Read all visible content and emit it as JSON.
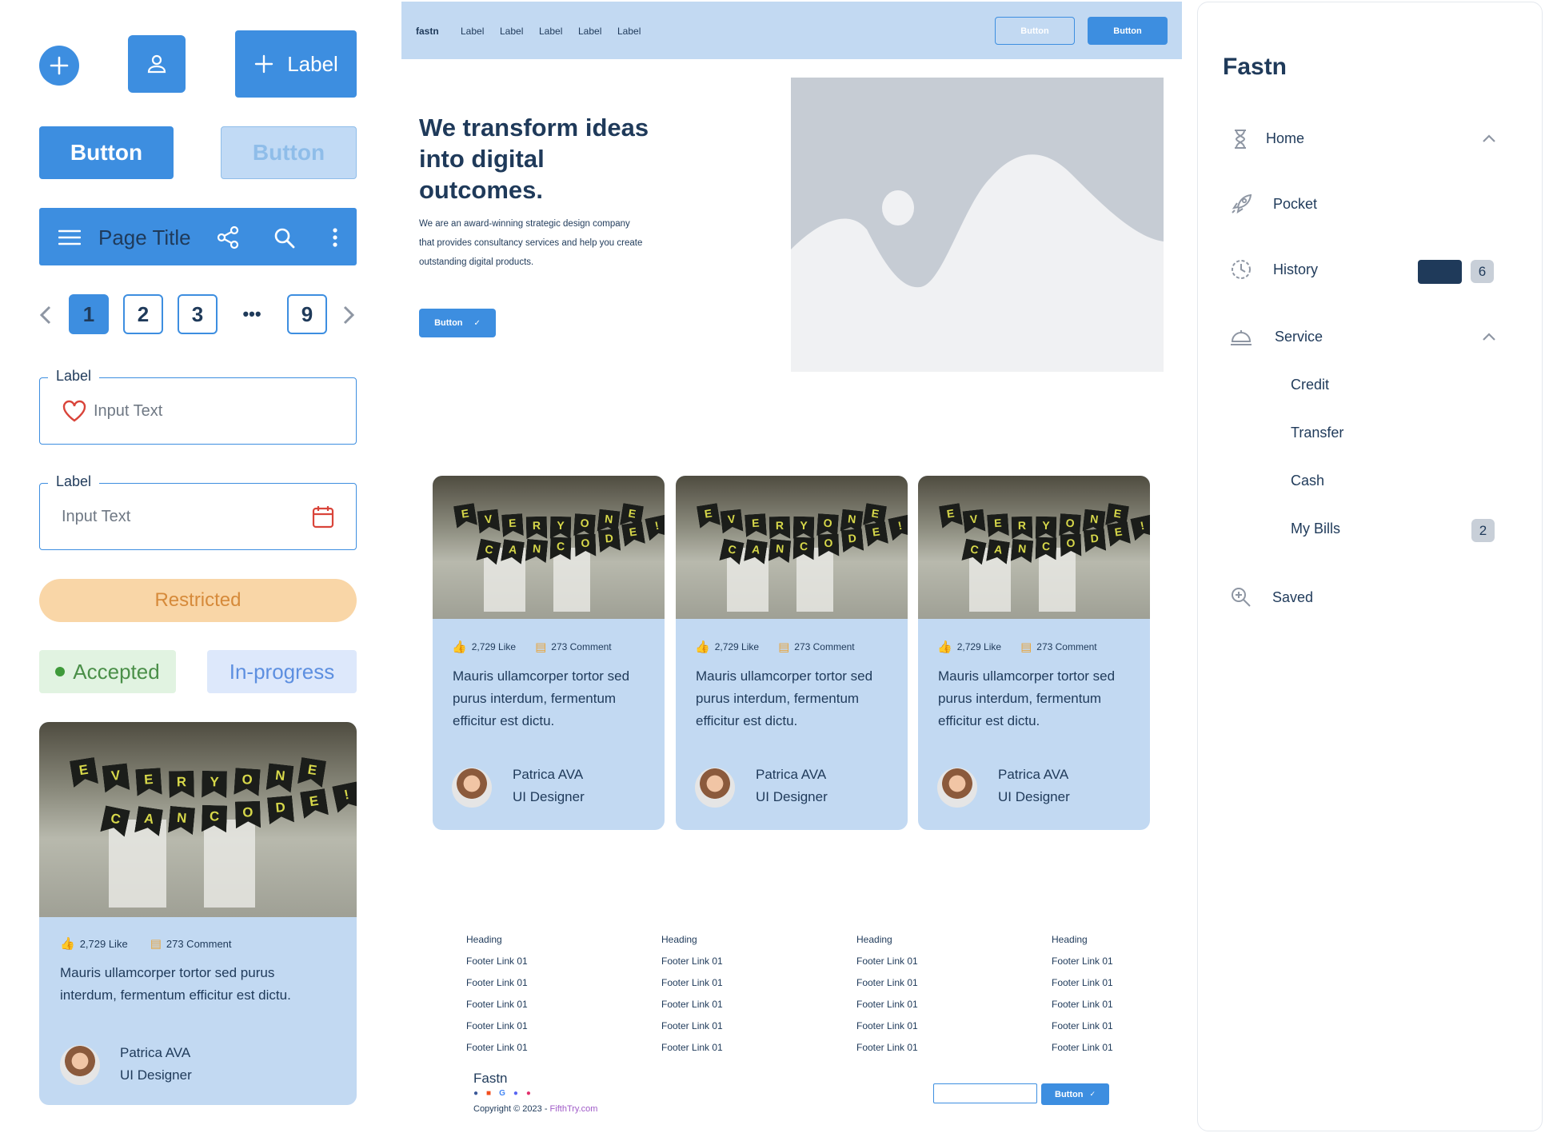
{
  "components": {
    "icon_button_label": "Label",
    "primary_button": "Button",
    "disabled_button": "Button",
    "appbar_title": "Page Title",
    "pagination": [
      "1",
      "2",
      "3",
      "•••",
      "9"
    ],
    "field1": {
      "label": "Label",
      "value": "Input Text"
    },
    "field2": {
      "label": "Label",
      "value": "Input Text"
    },
    "restricted": "Restricted",
    "accepted": "Accepted",
    "in_progress": "In-progress",
    "card": {
      "likes": "2,729 Like",
      "comments": "273 Comment",
      "text": "Mauris ullamcorper tortor sed purus interdum, fermentum efficitur est dictu.",
      "author": "Patrica AVA",
      "role": "UI Designer"
    }
  },
  "photo": {
    "row1": [
      "E",
      "V",
      "E",
      "R",
      "Y",
      "O",
      "N",
      "E"
    ],
    "row2": [
      "C",
      "A",
      "N",
      "C",
      "O",
      "D",
      "E",
      "!"
    ]
  },
  "landing": {
    "brand": "fastn",
    "nav": [
      "Label",
      "Label",
      "Label",
      "Label",
      "Label"
    ],
    "outline_button": "Button",
    "solid_button": "Button",
    "heading": "We transform ideas into digital outcomes.",
    "para": "We are an award-winning strategic design company that provides consultancy services and help you create outstanding digital products.",
    "cta": "Button",
    "cards": [
      {
        "likes": "2,729 Like",
        "comments": "273 Comment",
        "text": "Mauris ullamcorper tortor sed purus interdum, fermentum efficitur est dictu.",
        "author": "Patrica AVA",
        "role": "UI Designer"
      },
      {
        "likes": "2,729 Like",
        "comments": "273 Comment",
        "text": "Mauris ullamcorper tortor sed purus interdum, fermentum efficitur est dictu.",
        "author": "Patrica AVA",
        "role": "UI Designer"
      },
      {
        "likes": "2,729 Like",
        "comments": "273 Comment",
        "text": "Mauris ullamcorper tortor sed purus interdum, fermentum efficitur est dictu.",
        "author": "Patrica AVA",
        "role": "UI Designer"
      }
    ],
    "footer": {
      "columns": [
        {
          "heading": "Heading",
          "links": [
            "Footer Link 01",
            "Footer Link 01",
            "Footer Link 01",
            "Footer Link 01",
            "Footer Link 01"
          ]
        },
        {
          "heading": "Heading",
          "links": [
            "Footer Link 01",
            "Footer Link 01",
            "Footer Link 01",
            "Footer Link 01",
            "Footer Link 01"
          ]
        },
        {
          "heading": "Heading",
          "links": [
            "Footer Link 01",
            "Footer Link 01",
            "Footer Link 01",
            "Footer Link 01",
            "Footer Link 01"
          ]
        },
        {
          "heading": "Heading",
          "links": [
            "Footer Link 01",
            "Footer Link 01",
            "Footer Link 01",
            "Footer Link 01",
            "Footer Link 01"
          ]
        }
      ],
      "brand": "Fastn",
      "copyright": "Copyright © 2023 - ",
      "copyright_link": "FifthTry.com",
      "subscribe_button": "Button"
    }
  },
  "sidebar": {
    "title": "Fastn",
    "items": [
      {
        "label": "Home",
        "icon": "hourglass-icon"
      },
      {
        "label": "Pocket",
        "icon": "rocket-icon"
      },
      {
        "label": "History",
        "icon": "clock-icon",
        "badge": "6"
      },
      {
        "label": "Service",
        "icon": "service-bell-icon"
      },
      {
        "label": "Saved",
        "icon": "zoom-icon"
      }
    ],
    "service_children": [
      {
        "label": "Credit"
      },
      {
        "label": "Transfer"
      },
      {
        "label": "Cash"
      },
      {
        "label": "My Bills",
        "badge": "2"
      }
    ]
  },
  "colors": {
    "primary": "#3d8ee0",
    "navy": "#1f3a5a",
    "card": "#c2d9f2",
    "warning": "#f9d6a7",
    "success": "#e1f3e1"
  }
}
